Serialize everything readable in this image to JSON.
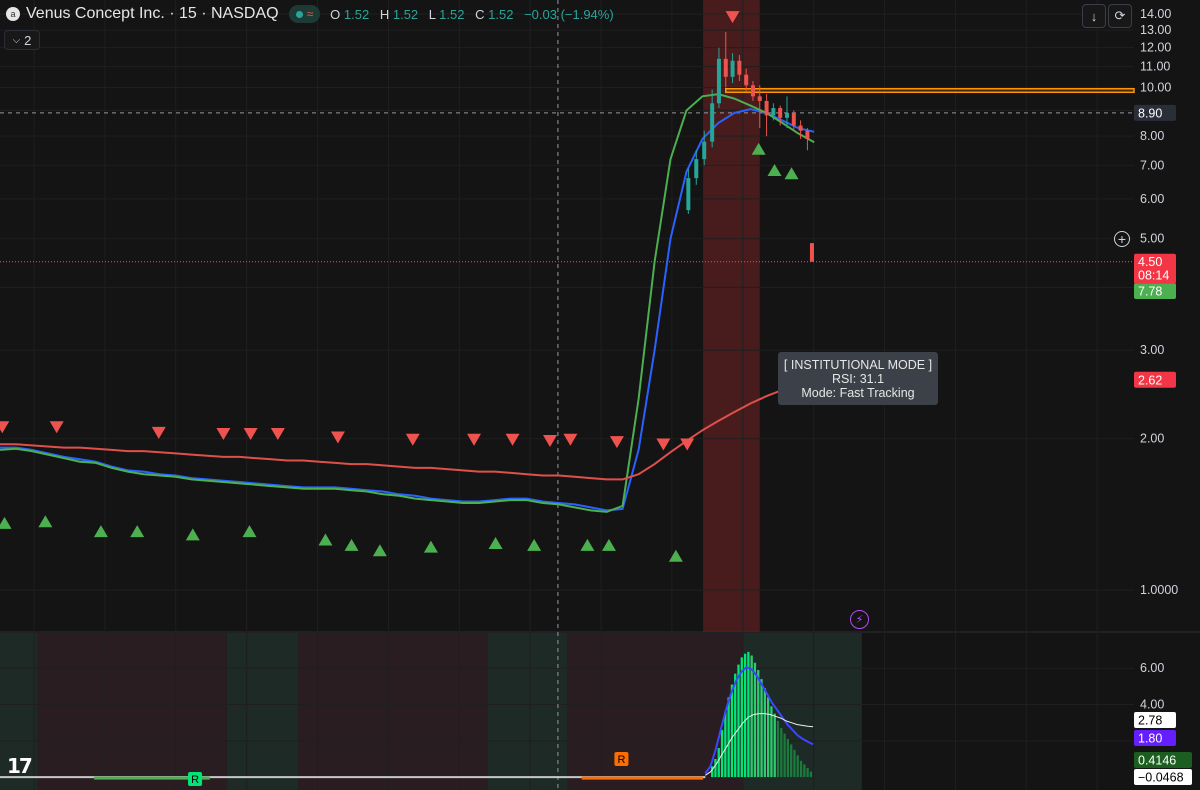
{
  "header": {
    "title": "Venus Concept Inc. · 15 · NASDAQ",
    "logo_glyph": "a",
    "open_label": "O",
    "open": "1.52",
    "high_label": "H",
    "high": "1.52",
    "low_label": "L",
    "low": "1.52",
    "close_label": "C",
    "close": "1.52",
    "change": "−0.03 (−1.94%)",
    "indicator_count": "2"
  },
  "toolbar": {
    "download_icon": "↓",
    "reload_icon": "⟳"
  },
  "tooltip": {
    "line1": "[ INSTITUTIONAL MODE ]",
    "line2": "RSI: 31.1",
    "line3": "Mode: Fast Tracking"
  },
  "markers": {
    "r_label_1": "R",
    "r_label_2": "R"
  },
  "colors": {
    "up": "#26a69a",
    "down": "#ef5350",
    "bright_green": "#00e676",
    "blue_line": "#2962ff",
    "green_line": "#4caf50",
    "red_line": "#e0504b",
    "orange_zone": "#ff9800",
    "purple": "#651fff"
  },
  "chart_data": [
    {
      "type": "line",
      "title": "Venus Concept Inc. · 15 · NASDAQ",
      "y_scale": "log",
      "ylim": [
        0.9,
        14.2
      ],
      "y_ticks": [
        "14.00",
        "13.00",
        "12.00",
        "11.00",
        "10.00",
        "9.00",
        "8.00",
        "7.00",
        "6.00",
        "5.00",
        "4.00",
        "3.00",
        "2.00",
        "1.0000"
      ],
      "y_tick_values": [
        14,
        13,
        12,
        11,
        10,
        9,
        8,
        7,
        6,
        5,
        4,
        3,
        2,
        1
      ],
      "crosshair_price": "8.90",
      "last_price": {
        "value": "4.50",
        "countdown": "08:14",
        "color": "#f23645"
      },
      "price_labels": [
        {
          "value": "8.16",
          "color": "#2962ff"
        },
        {
          "value": "7.78",
          "color": "#4caf50"
        },
        {
          "value": "2.62",
          "color": "#f23645"
        }
      ],
      "resistance_zone": [
        9.78,
        9.94
      ],
      "highlight_bar_range": [
        0.62,
        0.67
      ],
      "series": [
        {
          "name": "blue_ma",
          "values": [
            1.92,
            1.92,
            1.9,
            1.87,
            1.84,
            1.82,
            1.8,
            1.76,
            1.73,
            1.72,
            1.7,
            1.69,
            1.67,
            1.66,
            1.65,
            1.64,
            1.63,
            1.62,
            1.61,
            1.6,
            1.6,
            1.6,
            1.59,
            1.58,
            1.57,
            1.55,
            1.54,
            1.52,
            1.51,
            1.5,
            1.5,
            1.51,
            1.52,
            1.52,
            1.5,
            1.49,
            1.48,
            1.46,
            1.44,
            1.45,
            1.9,
            3.0,
            5.0,
            6.8,
            7.9,
            8.5,
            8.9,
            9.05,
            8.9,
            8.6,
            8.3,
            8.16
          ]
        },
        {
          "name": "green_ma",
          "values": [
            1.9,
            1.91,
            1.89,
            1.86,
            1.83,
            1.8,
            1.79,
            1.75,
            1.72,
            1.7,
            1.69,
            1.68,
            1.66,
            1.65,
            1.64,
            1.63,
            1.62,
            1.61,
            1.6,
            1.59,
            1.59,
            1.59,
            1.58,
            1.57,
            1.55,
            1.54,
            1.52,
            1.51,
            1.5,
            1.49,
            1.49,
            1.5,
            1.51,
            1.51,
            1.49,
            1.48,
            1.46,
            1.44,
            1.43,
            1.47,
            2.4,
            4.5,
            7.2,
            9.0,
            9.6,
            9.7,
            9.5,
            9.2,
            8.9,
            8.5,
            8.1,
            7.78
          ]
        },
        {
          "name": "red_ma",
          "values": [
            1.95,
            1.95,
            1.94,
            1.93,
            1.92,
            1.92,
            1.91,
            1.9,
            1.89,
            1.89,
            1.88,
            1.87,
            1.86,
            1.85,
            1.84,
            1.84,
            1.83,
            1.82,
            1.81,
            1.81,
            1.8,
            1.79,
            1.78,
            1.78,
            1.77,
            1.76,
            1.75,
            1.75,
            1.74,
            1.73,
            1.72,
            1.72,
            1.71,
            1.7,
            1.69,
            1.69,
            1.68,
            1.67,
            1.66,
            1.66,
            1.7,
            1.78,
            1.88,
            1.98,
            2.08,
            2.17,
            2.26,
            2.35,
            2.43,
            2.5,
            2.57,
            2.62
          ]
        }
      ],
      "candles": [
        {
          "x": 0.607,
          "open": 5.7,
          "close": 6.6,
          "high": 6.9,
          "low": 5.6
        },
        {
          "x": 0.614,
          "open": 6.6,
          "close": 7.2,
          "high": 7.5,
          "low": 6.4
        },
        {
          "x": 0.621,
          "open": 7.2,
          "close": 7.8,
          "high": 8.2,
          "low": 7.0
        },
        {
          "x": 0.628,
          "open": 7.8,
          "close": 9.3,
          "high": 9.9,
          "low": 7.6
        },
        {
          "x": 0.634,
          "open": 9.3,
          "close": 11.4,
          "high": 12.0,
          "low": 9.1
        },
        {
          "x": 0.64,
          "open": 11.4,
          "close": 10.5,
          "high": 12.9,
          "low": 10.0
        },
        {
          "x": 0.646,
          "open": 10.5,
          "close": 11.3,
          "high": 11.7,
          "low": 10.2
        },
        {
          "x": 0.652,
          "open": 11.3,
          "close": 10.6,
          "high": 11.6,
          "low": 10.3
        },
        {
          "x": 0.658,
          "open": 10.6,
          "close": 10.1,
          "high": 10.9,
          "low": 9.8
        },
        {
          "x": 0.664,
          "open": 10.1,
          "close": 9.6,
          "high": 10.3,
          "low": 9.4
        },
        {
          "x": 0.67,
          "open": 9.6,
          "close": 9.4,
          "high": 10.1,
          "low": 8.3
        },
        {
          "x": 0.676,
          "open": 9.4,
          "close": 8.8,
          "high": 9.7,
          "low": 8.0
        },
        {
          "x": 0.682,
          "open": 8.8,
          "close": 9.1,
          "high": 9.3,
          "low": 8.6
        },
        {
          "x": 0.688,
          "open": 9.1,
          "close": 8.7,
          "high": 9.2,
          "low": 8.4
        },
        {
          "x": 0.694,
          "open": 8.7,
          "close": 8.9,
          "high": 9.6,
          "low": 8.3
        },
        {
          "x": 0.7,
          "open": 8.9,
          "close": 8.4,
          "high": 9.0,
          "low": 8.2
        },
        {
          "x": 0.706,
          "open": 8.4,
          "close": 8.2,
          "high": 8.6,
          "low": 7.9
        },
        {
          "x": 0.712,
          "open": 8.2,
          "close": 7.9,
          "high": 8.3,
          "low": 7.5
        },
        {
          "x": 0.716,
          "open": 4.9,
          "close": 4.5,
          "high": 4.9,
          "low": 4.5
        }
      ]
    },
    {
      "type": "bar",
      "title": "oscillator",
      "ylim": [
        -0.6,
        7.5
      ],
      "y_ticks": [
        "6.00",
        "4.00",
        "2.00"
      ],
      "y_tick_values": [
        6,
        4,
        2
      ],
      "price_labels": [
        {
          "value": "2.78",
          "color": "#ffffff",
          "text_color": "#000000"
        },
        {
          "value": "1.80",
          "color": "#651fff"
        },
        {
          "value": "0.4146",
          "color": "#1b5e20"
        },
        {
          "value": "−0.0468",
          "color": "#ffffff",
          "text_color": "#000000"
        }
      ],
      "histogram": [
        0.6,
        1.0,
        1.6,
        2.6,
        3.6,
        4.4,
        5.1,
        5.7,
        6.2,
        6.6,
        6.8,
        6.9,
        6.7,
        6.3,
        5.9,
        5.4,
        4.9,
        4.4,
        3.9,
        3.5,
        3.1,
        2.7,
        2.4,
        2.1,
        1.8,
        1.5,
        1.2,
        0.9,
        0.7,
        0.5,
        0.3
      ],
      "series": [
        {
          "name": "fast_line",
          "values": [
            0.2,
            0.6,
            1.5,
            2.6,
            3.7,
            4.6,
            5.3,
            5.8,
            6.05,
            5.95,
            5.6,
            5.1,
            4.6,
            4.1,
            3.7,
            3.3,
            2.9,
            2.6,
            2.3,
            2.1,
            1.95,
            1.8
          ]
        },
        {
          "name": "slow_line",
          "values": [
            0.1,
            0.3,
            0.7,
            1.2,
            1.7,
            2.2,
            2.6,
            3.0,
            3.3,
            3.45,
            3.5,
            3.5,
            3.45,
            3.35,
            3.25,
            3.1,
            3.0,
            2.9,
            2.85,
            2.8,
            2.78
          ]
        }
      ]
    }
  ]
}
